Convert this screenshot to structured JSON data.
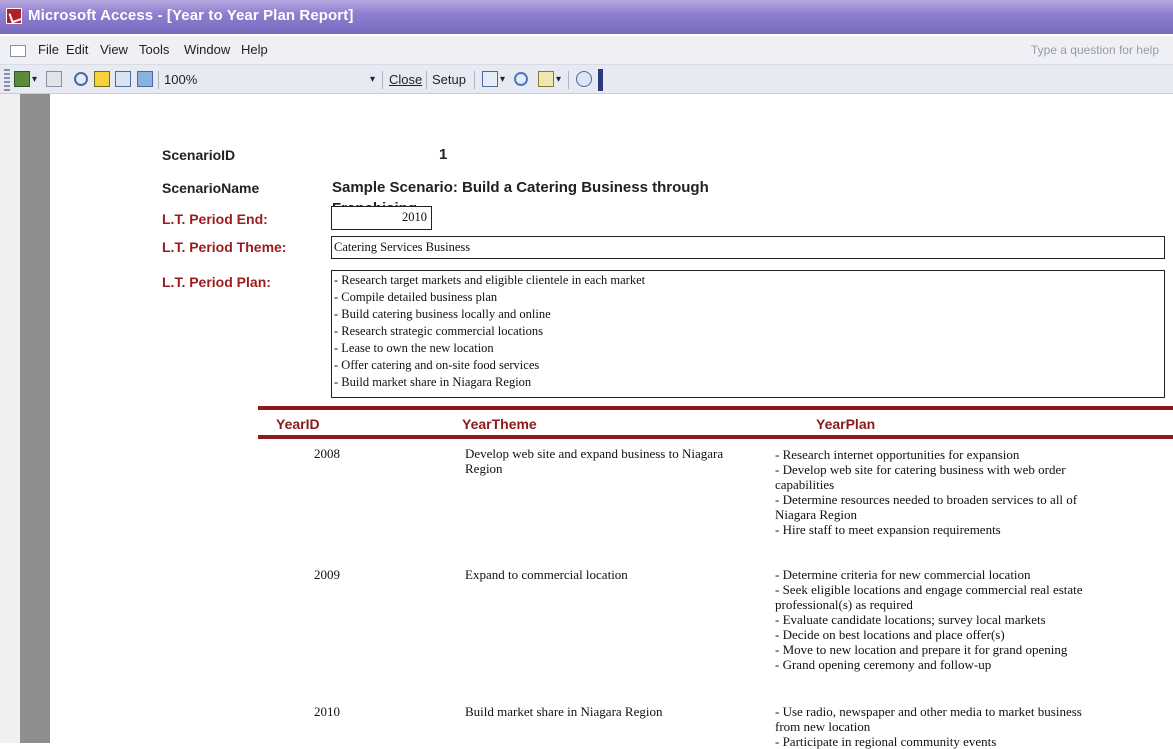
{
  "window": {
    "title": "Microsoft Access - [Year to Year Plan Report]"
  },
  "menu": {
    "items": [
      "File",
      "Edit",
      "View",
      "Tools",
      "Window",
      "Help"
    ],
    "help_placeholder": "Type a question for help"
  },
  "toolbar": {
    "zoom": "100%",
    "close_label": "Close",
    "setup_label": "Setup"
  },
  "report": {
    "scenario_id_label": "ScenarioID",
    "scenario_id_value": "1",
    "scenario_name_label": "ScenarioName",
    "scenario_name_line1": "Sample Scenario:  Build a Catering Business through",
    "scenario_name_line2": "Franchising",
    "period_end_label": "L.T. Period End:",
    "period_end_value": "2010",
    "period_theme_label": "L.T. Period Theme:",
    "period_theme_value": "Catering Services Business",
    "period_plan_label": "L.T. Period Plan:",
    "period_plan_lines": [
      "- Research target markets and eligible clientele in each market",
      "- Compile detailed business plan",
      "- Build catering business locally and online",
      "- Research strategic commercial locations",
      "- Lease to own the new location",
      "- Offer catering and on-site food services",
      "- Build market share in Niagara Region"
    ],
    "columns": {
      "year_id": "YearID",
      "year_theme": "YearTheme",
      "year_plan": "YearPlan"
    },
    "rows": [
      {
        "year": "2008",
        "theme_lines": [
          "Develop web site and expand business to Niagara",
          "Region"
        ],
        "plan_lines": [
          "- Research internet opportunities for expansion",
          "- Develop web site for catering business with web order",
          "capabilities",
          "- Determine resources needed to broaden services to all of",
          "Niagara Region",
          "- Hire staff to meet expansion requirements"
        ]
      },
      {
        "year": "2009",
        "theme_lines": [
          "Expand to commercial location"
        ],
        "plan_lines": [
          "- Determine criteria for new commercial location",
          "- Seek eligible locations and engage commercial real estate",
          "professional(s) as required",
          "- Evaluate candidate locations; survey local markets",
          "- Decide on best locations and place offer(s)",
          "- Move to new location and prepare it for grand opening",
          "- Grand opening ceremony and follow-up"
        ]
      },
      {
        "year": "2010",
        "theme_lines": [
          "Build market share in Niagara Region"
        ],
        "plan_lines": [
          "- Use radio, newspaper and other media to market business",
          "from new location",
          "- Participate in regional community events"
        ]
      }
    ]
  }
}
